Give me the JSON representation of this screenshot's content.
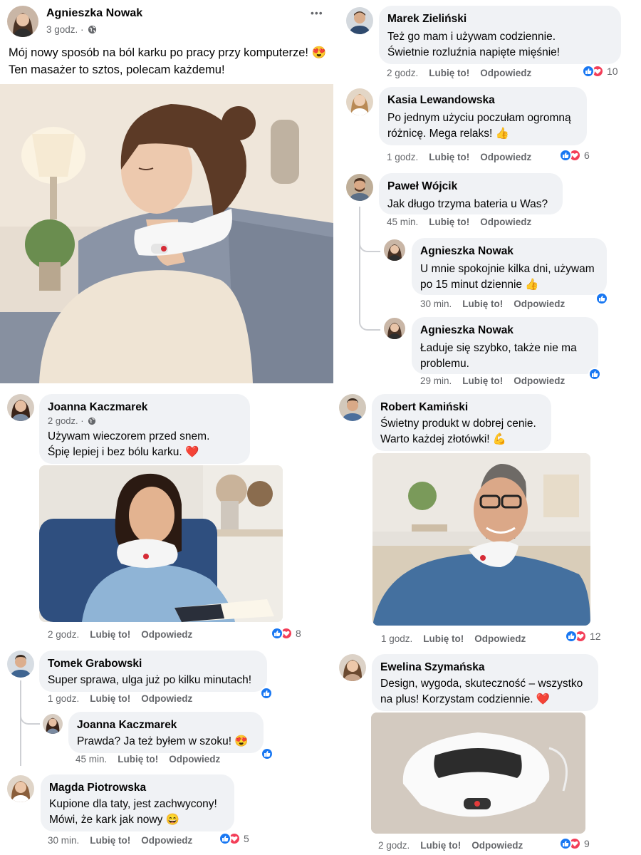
{
  "post": {
    "author": "Agnieszka Nowak",
    "time": "3 godz. ·",
    "visibility_icon": "globe-icon",
    "line1": "Mój nowy sposób na ból karku po pracy przy komputerze! 😍",
    "line2": "Ten masażer to sztos, polecam każdemu!",
    "more_icon": "more-options-icon",
    "more_label": "•••"
  },
  "labels": {
    "like": "Lubię to!",
    "reply": "Odpowiedz"
  },
  "colors": {
    "like": "#1877f2",
    "love": "#f33e58",
    "bubble": "#f0f2f5",
    "meta": "#65676b"
  },
  "comments": {
    "marek": {
      "name": "Marek Zieliński",
      "line1": "Też go mam i używam codziennie.",
      "line2": "Świetnie rozluźnia napięte mięśnie!",
      "time": "2 godz.",
      "count": "10"
    },
    "kasia": {
      "name": "Kasia Lewandowska",
      "line1": "Po jednym użyciu poczułam ogromną",
      "line2": "różnicę. Mega relaks! 👍",
      "time": "1 godz.",
      "count": "6"
    },
    "pawel": {
      "name": "Paweł Wójcik",
      "line1": "Jak długo trzyma bateria u Was?",
      "time": "45 min."
    },
    "agn1": {
      "name": "Agnieszka Nowak",
      "line1": "U mnie spokojnie kilka dni, używam",
      "line2": "po 15 minut dziennie 👍",
      "time": "30 min."
    },
    "agn2": {
      "name": "Agnieszka Nowak",
      "line1": "Ładuje się szybko, także nie ma",
      "line2": "problemu.",
      "time": "29 min."
    },
    "joanna": {
      "name": "Joanna Kaczmarek",
      "time_top": "2 godz. ·",
      "line1": "Używam wieczorem przed snem.",
      "line2": "Śpię lepiej i bez bólu karku. ❤️",
      "time": "2 godz.",
      "count": "8"
    },
    "robert": {
      "name": "Robert Kamiński",
      "line1": "Świetny produkt w dobrej cenie.",
      "line2": "Warto każdej złotówki! 💪",
      "time": "1 godz.",
      "count": "12"
    },
    "tomek": {
      "name": "Tomek Grabowski",
      "line1": "Super sprawa, ulga już po kilku minutach!",
      "time": "1 godz."
    },
    "joanna2": {
      "name": "Joanna Kaczmarek",
      "line1": "Prawda? Ja też byłem w szoku! 😍",
      "time": "45 min."
    },
    "magda": {
      "name": "Magda Piotrowska",
      "line1": "Kupione dla taty, jest zachwycony!",
      "line2": "Mówi, że kark jak nowy 😄",
      "time": "30 min.",
      "count": "5"
    },
    "ewelina": {
      "name": "Ewelina Szymańska",
      "line1": "Design, wygoda, skuteczność – wszystko",
      "line2": "na plus! Korzystam codziennie. ❤️",
      "time": "2 godz.",
      "count": "9"
    }
  }
}
